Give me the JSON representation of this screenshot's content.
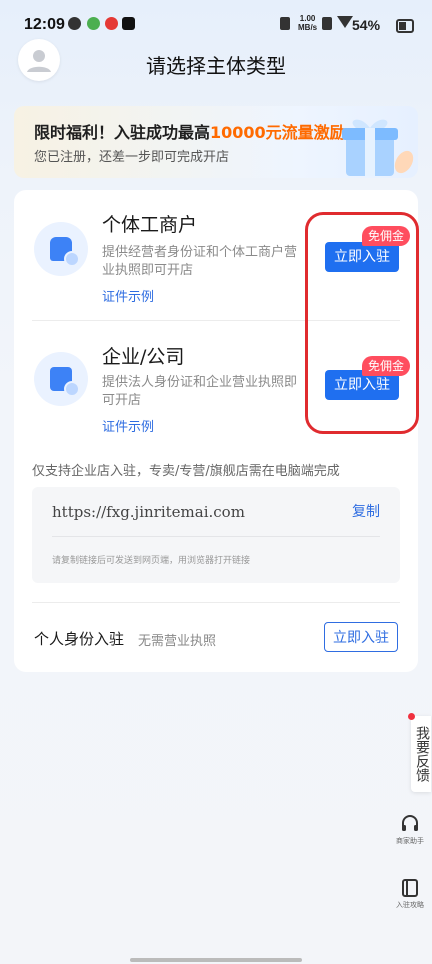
{
  "status_bar": {
    "time": "12:09",
    "net_speed_top": "1.00",
    "net_speed_bottom": "MB/s",
    "battery": "54%"
  },
  "header": {
    "title": "请选择主体类型"
  },
  "banner": {
    "title_prefix": "限时福利！入驻成功最高",
    "title_highlight": "10000元流量激励",
    "subtitle": "您已注册，还差一步即可完成开店"
  },
  "options": [
    {
      "title": "个体工商户",
      "desc": "提供经营者身份证和个体工商户营业执照即可开店",
      "link": "证件示例",
      "badge": "免佣金",
      "button": "立即入驻"
    },
    {
      "title": "企业/公司",
      "desc": "提供法人身份证和企业营业执照即可开店",
      "link": "证件示例",
      "badge": "免佣金",
      "button": "立即入驻"
    }
  ],
  "enterprise_note": "仅支持企业店入驻，专卖/专营/旗舰店需在电脑端完成",
  "url_box": {
    "url": "https://fxg.jinritemai.com",
    "copy": "复制",
    "hint": "请复制链接后可发送到网页端，用浏览器打开链接"
  },
  "personal": {
    "title": "个人身份入驻",
    "subtitle": "无需营业执照",
    "button": "立即入驻"
  },
  "side_tools": {
    "feedback": "我要反馈",
    "assistant": "商家助手",
    "guide": "入驻攻略"
  },
  "colors": {
    "primary": "#1f6ff0",
    "badge": "#ff4d5e",
    "highlight": "#ff6a00",
    "annotation": "#e02b2f"
  }
}
